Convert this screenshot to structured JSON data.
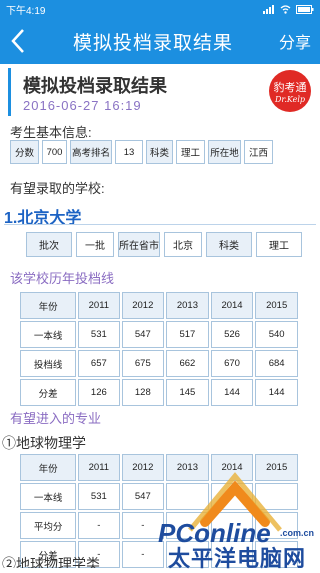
{
  "status": {
    "time": "下午4:19",
    "icons": [
      "signal-icon",
      "wifi-icon",
      "battery-icon"
    ]
  },
  "nav": {
    "title": "模拟投档录取结果",
    "share_label": "分享"
  },
  "header": {
    "title": "模拟投档录取结果",
    "date": "2016-06-27 16:19",
    "badge_text": "豹考通",
    "badge_sub": "Dr.Kelp"
  },
  "student": {
    "section_label": "考生基本信息:",
    "fields": [
      {
        "label": "分数",
        "value": "700"
      },
      {
        "label": "高考排名",
        "value": "13"
      },
      {
        "label": "科类",
        "value": "理工"
      },
      {
        "label": "所在地",
        "value": "江西"
      }
    ]
  },
  "schools_label": "有望录取的学校:",
  "school": {
    "title": "1.北京大学",
    "info": [
      {
        "label": "批次",
        "value": "一批"
      },
      {
        "label": "所在省市",
        "value": "北京"
      },
      {
        "label": "科类",
        "value": "理工"
      }
    ],
    "history_label": "该学校历年投档线",
    "history": {
      "header": [
        "年份",
        "2011",
        "2012",
        "2013",
        "2014",
        "2015"
      ],
      "rows": [
        [
          "一本线",
          "531",
          "547",
          "517",
          "526",
          "540"
        ],
        [
          "投档线",
          "657",
          "675",
          "662",
          "670",
          "684"
        ],
        [
          "分差",
          "126",
          "128",
          "145",
          "144",
          "144"
        ]
      ]
    },
    "majors_label": "有望进入的专业",
    "major": {
      "title": "①地球物理学",
      "header": [
        "年份",
        "2011",
        "2012",
        "2013",
        "2014",
        "2015"
      ],
      "rows": [
        [
          "一本线",
          "531",
          "547",
          "",
          "",
          ""
        ],
        [
          "平均分",
          "-",
          "-",
          "",
          "",
          ""
        ],
        [
          "分差",
          "-",
          "-",
          "",
          "",
          ""
        ]
      ]
    },
    "next_major_partial": "②地球物理学类"
  },
  "watermark": {
    "name": "PConline",
    "domain": ".com.cn",
    "sub": "太平洋电脑网"
  }
}
